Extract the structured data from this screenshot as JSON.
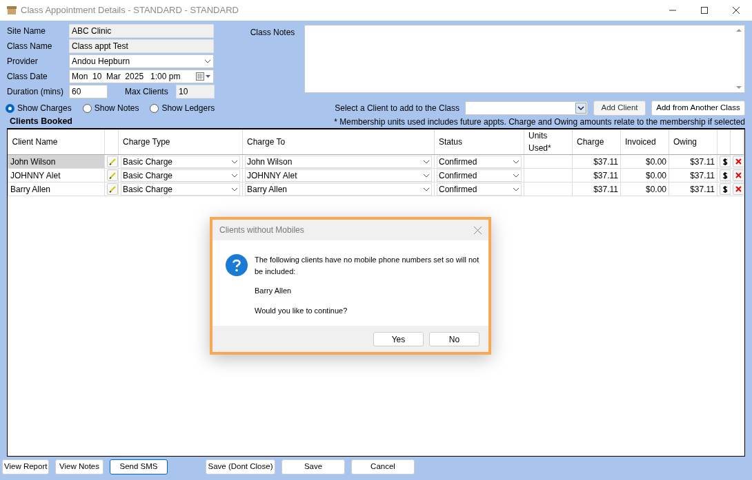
{
  "window": {
    "title": "Class Appointment Details - STANDARD - STANDARD"
  },
  "form": {
    "site_name": {
      "label": "Site Name",
      "value": "ABC Clinic"
    },
    "class_name": {
      "label": "Class Name",
      "value": "Class appt Test"
    },
    "provider": {
      "label": "Provider",
      "value": "Andou Hepburn"
    },
    "class_date": {
      "label": "Class Date",
      "value": "Mon  10  Mar  2025   1:00 pm"
    },
    "duration": {
      "label": "Duration (mins)",
      "value": "60"
    },
    "max_clients": {
      "label": "Max Clients",
      "value": "10"
    },
    "class_notes": {
      "label": "Class Notes"
    }
  },
  "view_options": [
    {
      "label": "Show Charges",
      "selected": true
    },
    {
      "label": "Show Notes",
      "selected": false
    },
    {
      "label": "Show Ledgers",
      "selected": false
    }
  ],
  "client_picker": {
    "label": "Select a Client to add to the Class",
    "buttons": [
      "Add Client",
      "Add from Another Class"
    ]
  },
  "table": {
    "title": "Clients Booked",
    "note": "* Membership units used includes future appts. Charge and Owing amounts relate to the membership if selected",
    "columns": [
      "Client Name",
      "Charge Type",
      "Charge To",
      "Status",
      "Units Used*",
      "Charge",
      "Invoiced",
      "Owing"
    ],
    "rows": [
      {
        "client_name": "John Wilson",
        "charge_type": "Basic Charge",
        "charge_to": "John Wilson",
        "status": "Confirmed",
        "charge": "$37.11",
        "invoiced": "$0.00",
        "owing": "$37.11",
        "selected": true
      },
      {
        "client_name": "JOHNNY Alet",
        "charge_type": "Basic Charge",
        "charge_to": "JOHNNY Alet",
        "status": "Confirmed",
        "charge": "$37.11",
        "invoiced": "$0.00",
        "owing": "$37.11",
        "selected": false
      },
      {
        "client_name": "Barry Allen",
        "charge_type": "Basic Charge",
        "charge_to": "Barry Allen",
        "status": "Confirmed",
        "charge": "$37.11",
        "invoiced": "$0.00",
        "owing": "$37.11",
        "selected": false
      }
    ]
  },
  "dialog": {
    "title": "Clients without Mobiles",
    "message": "The following clients have no mobile phone numbers set so will not be included:",
    "clients": [
      "Barry Allen"
    ],
    "question": "Would you like to continue?",
    "buttons": [
      "Yes",
      "No"
    ]
  },
  "footer": {
    "left": [
      {
        "label": "View Report",
        "focused": false
      },
      {
        "label": "View Notes",
        "focused": false
      },
      {
        "label": "Send SMS",
        "focused": true
      }
    ],
    "right": [
      {
        "label": "Save (Dont Close)",
        "focused": false
      },
      {
        "label": "Save",
        "focused": false
      },
      {
        "label": "Cancel",
        "focused": false
      }
    ]
  }
}
